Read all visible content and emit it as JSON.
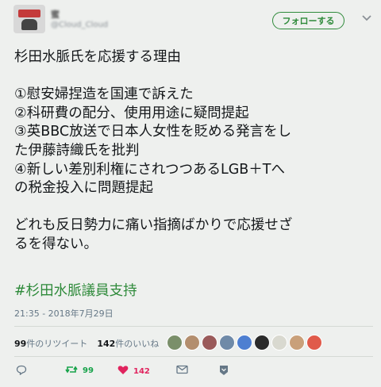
{
  "header": {
    "display_name": "蜜",
    "handle": "@Cloud_Cloud",
    "follow_label": "フォローする"
  },
  "tweet": {
    "lines": [
      "杉田水脈氏を応援する理由",
      "",
      "①慰安婦捏造を国連で訴えた",
      "②科研費の配分、使用用途に疑問提起",
      "③英BBC放送で日本人女性を貶める発言をし",
      "た伊藤詩織氏を批判",
      "④新しい差別利権にされつつあるLGB＋Tへ",
      "の税金投入に問題提起",
      "",
      "どれも反日勢力に痛い指摘ばかりで応援せざ",
      "るを得ない。"
    ],
    "hashtag": "#杉田水脈議員支持",
    "timestamp": "21:35 - 2018年7月29日"
  },
  "stats": {
    "retweets_count": "99",
    "retweets_label": "件のリツイート",
    "likes_count": "142",
    "likes_label": "件のいいね"
  },
  "liker_avatars": [
    "#7a8f6a",
    "#b38e6e",
    "#9a5a5a",
    "#6f8aa8",
    "#4e7fd1",
    "#2b2b2b",
    "#d9d9d0",
    "#c9a07a",
    "#e05a4a"
  ],
  "actions": {
    "reply_count": "",
    "retweet_count": "99",
    "like_count": "142"
  },
  "colors": {
    "accent": "#2e8a3a",
    "like": "#e0245e",
    "background": "#eef0ee"
  }
}
